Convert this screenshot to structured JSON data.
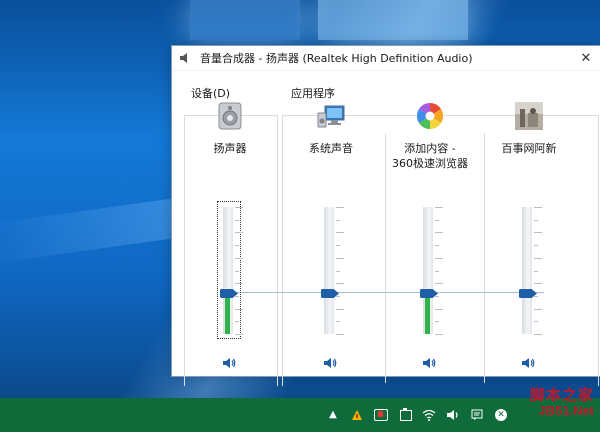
{
  "window": {
    "title": "音量合成器 - 扬声器 (Realtek High Definition Audio)",
    "close_symbol": "✕"
  },
  "groups": {
    "device_label": "设备(D)",
    "apps_label": "应用程序"
  },
  "channels": [
    {
      "id": "speaker",
      "label": "扬声器",
      "icon": "speaker-device-icon",
      "volume": 0.32,
      "level": 0.32
    },
    {
      "id": "system",
      "label": "系统声音",
      "icon": "system-sounds-icon",
      "volume": 0.32,
      "level": 0
    },
    {
      "id": "browser",
      "label": "添加内容 -\n360极速浏览器",
      "icon": "browser-360-icon",
      "volume": 0.32,
      "level": 0.32
    },
    {
      "id": "baishi",
      "label": "百事网阿新",
      "icon": "app-photo-icon",
      "volume": 0.32,
      "level": 0
    }
  ],
  "watermark": {
    "top": "脚本之家",
    "bottom": "JB51.Net"
  },
  "colors": {
    "thumb": "#1f5fa8",
    "meter": "#2db34a",
    "taskbar": "#0f6b3a"
  }
}
